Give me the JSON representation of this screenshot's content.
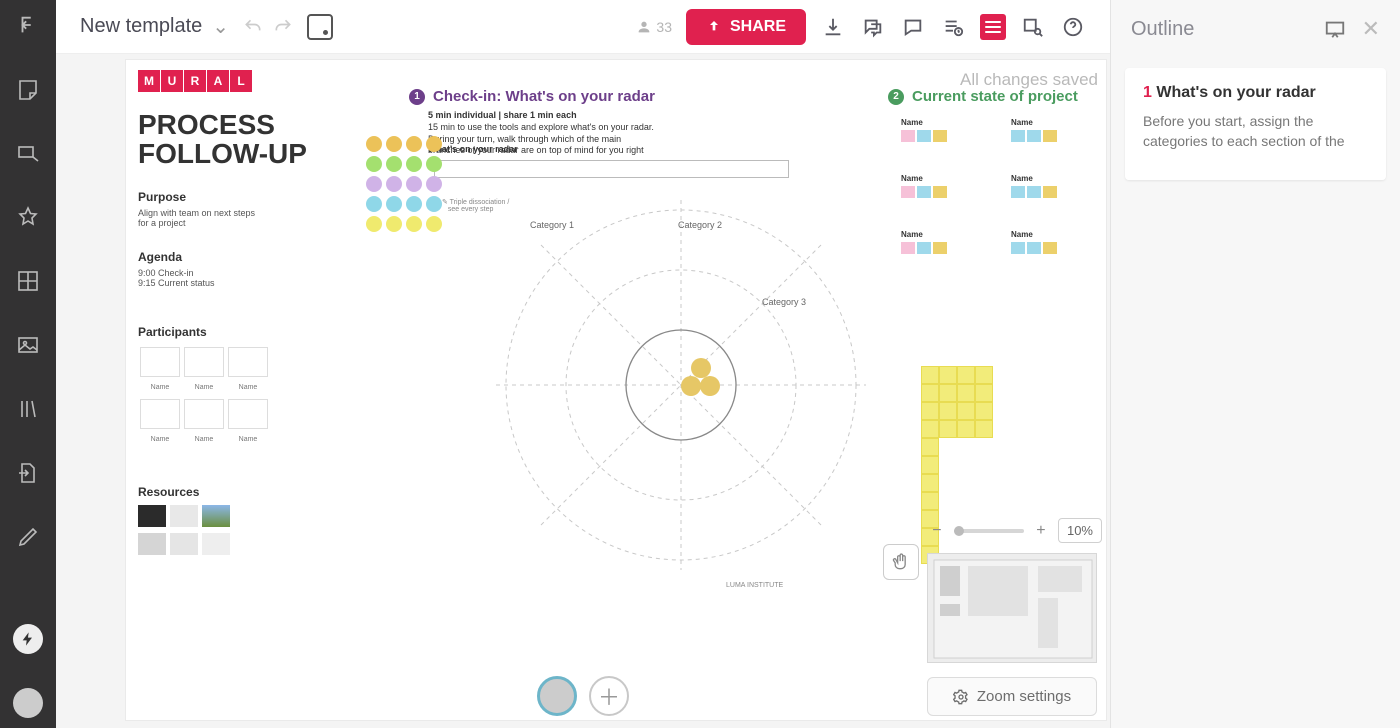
{
  "header": {
    "title": "New template",
    "collaborators_count": "33",
    "share_label": "SHARE",
    "saved_status": "All changes saved"
  },
  "outline": {
    "title": "Outline",
    "card": {
      "number": "1",
      "title": "What's on your radar",
      "body": "Before you start, assign the categories to each section of the radar (each pie slice)"
    }
  },
  "board": {
    "brand": "MURAL",
    "big_title_1": "PROCESS",
    "big_title_2": "FOLLOW-UP",
    "purpose": {
      "h": "Purpose",
      "body": "Align with team on next steps for a project"
    },
    "agenda": {
      "h": "Agenda",
      "l1": "9:00 Check-in",
      "l2": "9:15 Current status"
    },
    "participants": {
      "h": "Participants",
      "name": "Name"
    },
    "resources": {
      "h": "Resources"
    },
    "section1": {
      "num": "1",
      "title": "Check-in: What's on your radar"
    },
    "section2": {
      "num": "2",
      "title": "Current state of project"
    },
    "input_label": "What's on your radar",
    "categories": {
      "c1": "Category 1",
      "c2": "Category 2",
      "c3": "Category 3"
    },
    "name_label": "Name",
    "luma": "LUMA INSTITUTE"
  },
  "palette_colors": [
    "#ecc259",
    "#ecc259",
    "#ecc259",
    "#ecc259",
    "#a4e06f",
    "#a4e06f",
    "#a4e06f",
    "#a4e06f",
    "#d0b3e7",
    "#d0b3e7",
    "#d0b3e7",
    "#d0b3e7",
    "#8fd7e8",
    "#8fd7e8",
    "#8fd7e8",
    "#8fd7e8",
    "#f0ea6e",
    "#f0ea6e",
    "#f0ea6e",
    "#f0ea6e"
  ],
  "chip_rows": [
    [
      "#f6c1d8",
      "#9fd9eb",
      "#ecd06b"
    ],
    [
      "#9fd9eb",
      "#9fd9eb",
      "#ecd06b"
    ],
    [
      "#f6c1d8",
      "#9fd9eb",
      "#ecd06b"
    ],
    [
      "#9fd9eb",
      "#9fd9eb",
      "#ecd06b"
    ],
    [
      "#f6c1d8",
      "#9fd9eb",
      "#ecd06b"
    ],
    [
      "#9fd9eb",
      "#9fd9eb",
      "#ecd06b"
    ]
  ],
  "zoom": {
    "percent": "10%",
    "settings_label": "Zoom settings"
  }
}
